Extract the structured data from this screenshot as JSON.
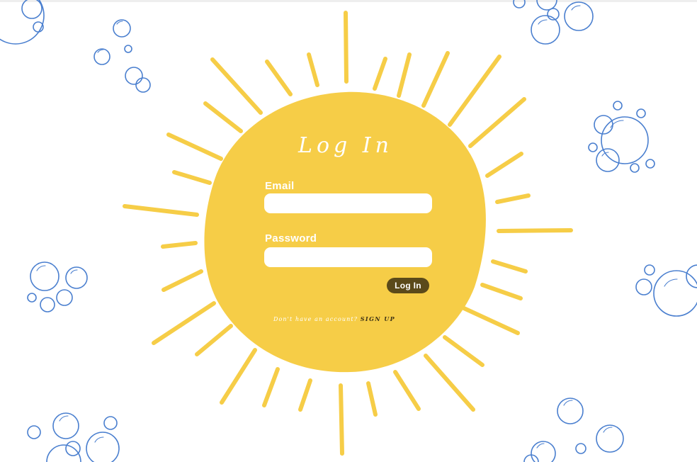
{
  "login": {
    "title": "Log In",
    "email_label": "Email",
    "email_value": "",
    "password_label": "Password",
    "password_value": "",
    "submit_label": "Log In",
    "signup_prompt": "Don't have an account?",
    "signup_link": "SIGN UP"
  },
  "colors": {
    "sun": "#f6cd47",
    "button": "#5b4a1a",
    "bubbles": "#4a7fcf",
    "background": "#ffffff"
  },
  "decorations": {
    "sun": "sun-illustration",
    "bubbles": "bubble-cluster"
  }
}
